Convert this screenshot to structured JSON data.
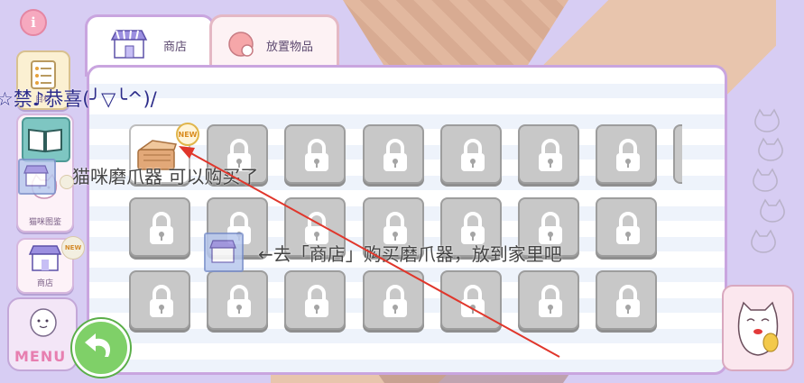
{
  "tabs": [
    {
      "label": "商店",
      "icon": "shop-icon",
      "active": true
    },
    {
      "label": "放置物品",
      "icon": "ball-icon",
      "active": false
    }
  ],
  "notice": "☆禁♪恭喜(╯▽╰^)/",
  "hint_1": "猫咪磨爪器 可以购买了",
  "hint_2": "←去「商店」购买磨爪器，放到家里吧",
  "new_badge": "NEW",
  "sidebar": {
    "cat_book_label": "猫咪图鉴",
    "shop_label": "商店",
    "menu_label": "MENU",
    "list_label": "目标",
    "new_badge": "NEW"
  },
  "grid": {
    "rows": 3,
    "cols": 7,
    "unlocked": [
      [
        0,
        0
      ]
    ]
  },
  "colors": {
    "background": "#d7cdf3",
    "panel_border": "#c9a5df",
    "locked_slot": "#c8c8c8",
    "arrow": "#e0362b",
    "back_button": "#7fd068"
  }
}
